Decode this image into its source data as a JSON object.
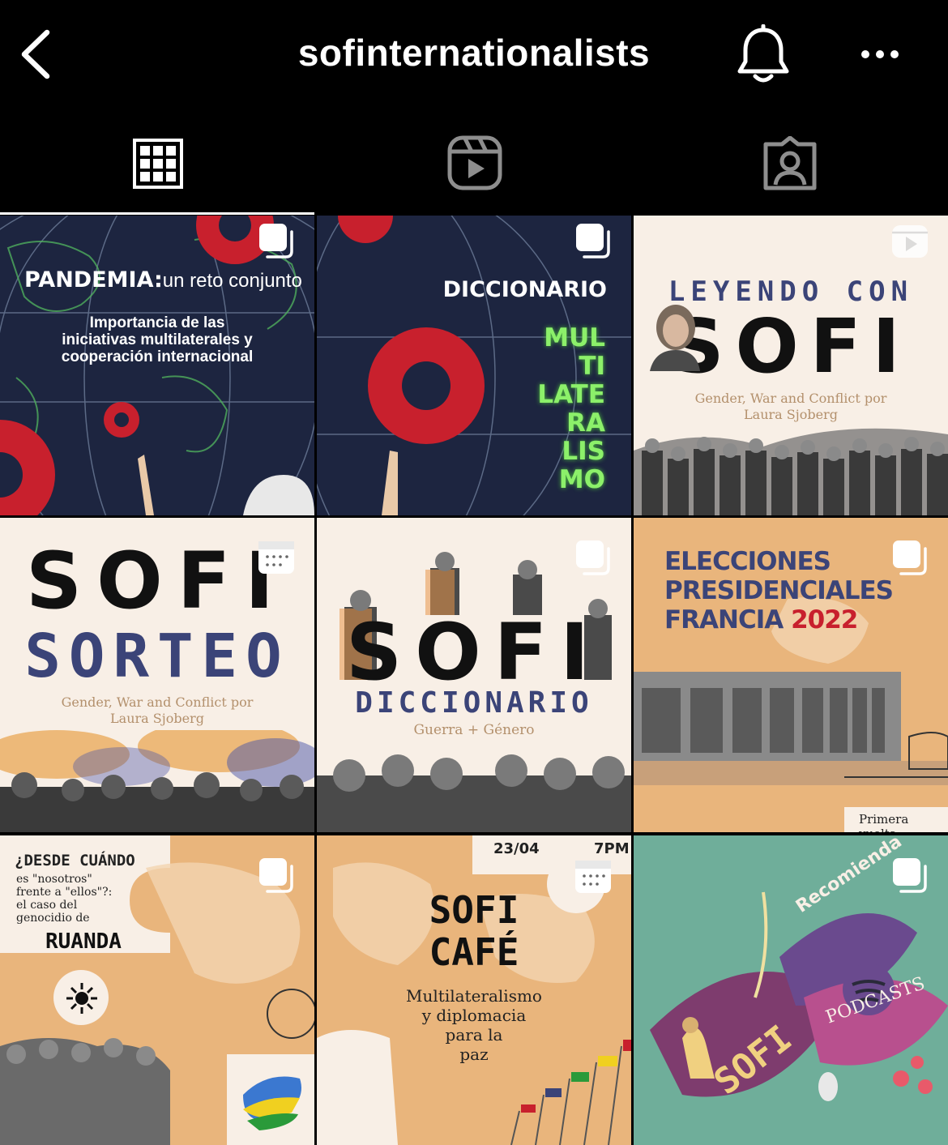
{
  "header": {
    "username": "sofinternationalists",
    "back_icon": "chevron-left-icon",
    "bell_icon": "bell-icon",
    "more_icon": "more-horizontal-icon"
  },
  "tabs": [
    {
      "name": "grid",
      "icon": "grid-icon",
      "active": true
    },
    {
      "name": "reels",
      "icon": "reels-icon",
      "active": false
    },
    {
      "name": "tagged",
      "icon": "tagged-person-icon",
      "active": false
    }
  ],
  "posts": [
    {
      "type": "carousel",
      "title_bold": "PANDEMIA:",
      "title_rest": "un reto conjunto",
      "subtitle_1": "Importancia de las",
      "subtitle_2": "iniciativas multilaterales y",
      "subtitle_3": "cooperación internacional"
    },
    {
      "type": "carousel",
      "heading": "DICCIONARIO",
      "word_lines": [
        "MUL",
        "TI",
        "LATE",
        "RA",
        "LIS",
        "MO"
      ]
    },
    {
      "type": "reel",
      "kicker": "LEYENDO CON",
      "brand": "SOFI",
      "book_1": "Gender, War and Conflict por",
      "book_2": "Laura Sjoberg"
    },
    {
      "type": "carousel",
      "brand": "SOFI",
      "heading": "SORTEO",
      "book_1": "Gender, War and Conflict por",
      "book_2": "Laura Sjoberg"
    },
    {
      "type": "carousel",
      "brand": "SOFI",
      "heading": "DICCIONARIO",
      "sub": "Guerra + Género"
    },
    {
      "type": "carousel",
      "line_1": "ELECCIONES",
      "line_2": "PRESIDENCIALES",
      "line_3a": "FRANCIA",
      "line_3b": "2022",
      "footer": "Primera vuelta"
    },
    {
      "type": "carousel",
      "q_1": "¿DESDE CUÁNDO",
      "q_2": "es \"nosotros\"",
      "q_3": "frente a \"ellos\"?:",
      "q_4": "el caso del",
      "q_5": "genocidio de",
      "country": "RUANDA"
    },
    {
      "type": "carousel",
      "date": "23/04",
      "time": "7PM",
      "brand_1": "SOFI",
      "brand_2": "CAFÉ",
      "topic_1": "Multilateralismo",
      "topic_2": "y diplomacia",
      "topic_3": "para la",
      "topic_4": "paz"
    },
    {
      "type": "carousel",
      "recommend": "Recomienda",
      "podcasts": "PODCASTS",
      "brand": "SOFI"
    }
  ],
  "colors": {
    "background": "#000000",
    "navy": "#1d2540",
    "cream": "#f8efe6",
    "tan": "#e9b57c",
    "teal": "#6fae9a",
    "plum": "#7e3c6e",
    "gear_red": "#c8202d",
    "neon_green": "#8cf06a",
    "indigo": "#3b4478"
  }
}
